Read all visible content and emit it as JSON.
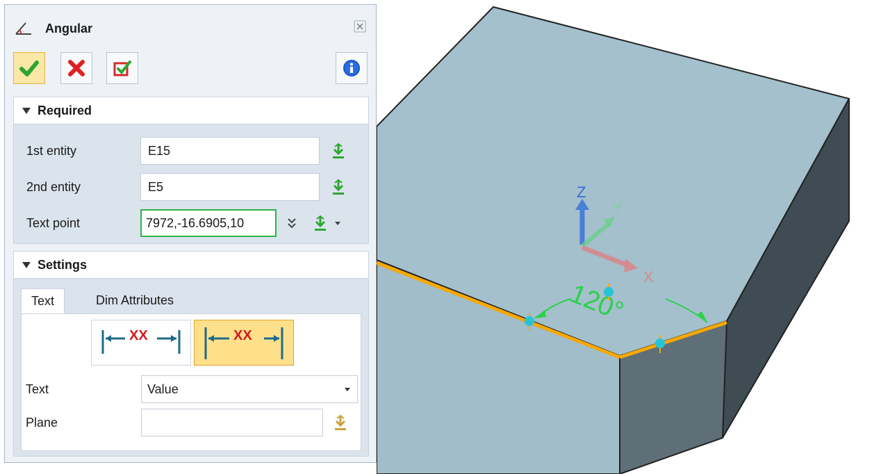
{
  "panel": {
    "title": "Angular",
    "toolbar": {
      "ok_icon": "checkmark-icon",
      "cancel_icon": "x-icon",
      "apply_icon": "apply-check-icon",
      "info_icon": "info-icon"
    },
    "required": {
      "header": "Required",
      "fields": [
        {
          "label": "1st entity",
          "value": "E15"
        },
        {
          "label": "2nd entity",
          "value": "E5"
        },
        {
          "label": "Text point",
          "value": "7972,-16.6905,10"
        }
      ]
    },
    "settings": {
      "header": "Settings",
      "tabs": [
        "Text",
        "Dim Attributes"
      ],
      "selected_tab": "Text",
      "alignment_label": "XX",
      "text_label": "Text",
      "text_value": "Value",
      "plane_label": "Plane",
      "plane_value": ""
    }
  },
  "viewport": {
    "axis_labels": {
      "z": "Z",
      "y": "Y",
      "x": "X"
    },
    "dimension_text": "120°",
    "colors": {
      "face_top": "#a3c0cc",
      "face_front": "#a0bdc9",
      "face_dark": "#3f4c53",
      "edge_highlight": "#f7a800",
      "dimension": "#2bd14a"
    }
  }
}
